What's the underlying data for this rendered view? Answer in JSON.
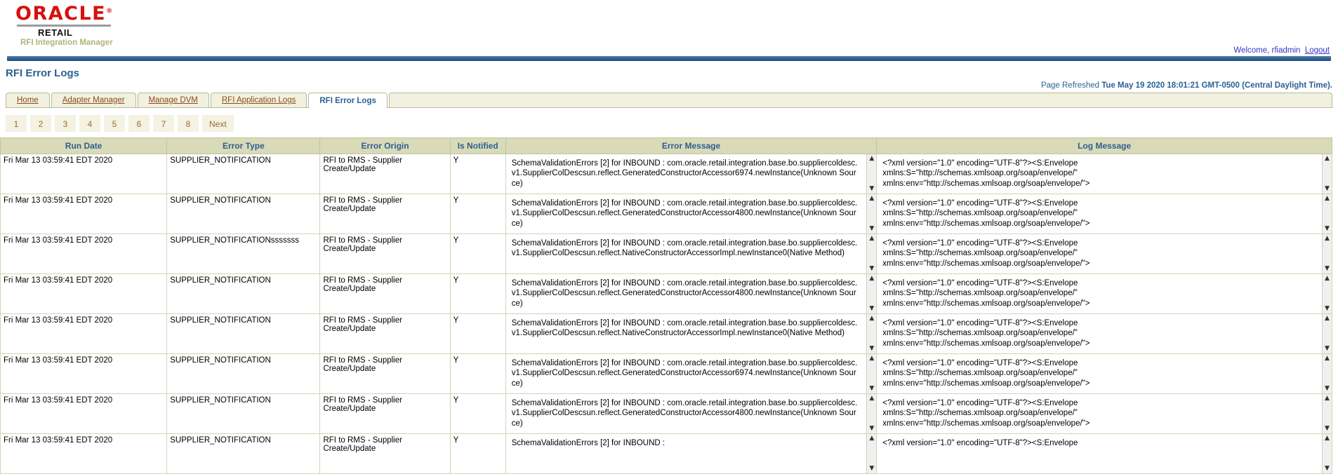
{
  "branding": {
    "oracle": "ORACLE",
    "registered": "®",
    "suite": "RETAIL",
    "app_name": "RFI Integration Manager"
  },
  "header": {
    "welcome": "Welcome, rfiadmin",
    "logout_label": "Logout"
  },
  "page": {
    "title": "RFI Error Logs",
    "refresh_label": "Page Refreshed",
    "refresh_value": "Tue May 19 2020 18:01:21 GMT-0500 (Central Daylight Time)."
  },
  "tabs": [
    {
      "label": "Home",
      "active": false
    },
    {
      "label": "Adapter Manager",
      "active": false
    },
    {
      "label": "Manage DVM",
      "active": false
    },
    {
      "label": "RFI Application Logs",
      "active": false
    },
    {
      "label": "RFI Error Logs",
      "active": true
    }
  ],
  "pager": [
    "1",
    "2",
    "3",
    "4",
    "5",
    "6",
    "7",
    "8",
    "Next"
  ],
  "table": {
    "columns": [
      "Run Date",
      "Error Type",
      "Error Origin",
      "Is Notified",
      "Error Message",
      "Log Message"
    ],
    "rows": [
      {
        "run_date": "Fri Mar 13 03:59:41 EDT 2020",
        "error_type": "SUPPLIER_NOTIFICATION",
        "error_origin": "RFI to RMS - Supplier Create/Update",
        "is_notified": "Y",
        "error_message": "SchemaValidationErrors [2] for INBOUND : com.oracle.retail.integration.base.bo.suppliercoldesc.v1.SupplierColDescsun.reflect.GeneratedConstructorAccessor6974.newInstance(Unknown Source)",
        "log_message": "<?xml version=\"1.0\" encoding=\"UTF-8\"?><S:Envelope\nxmlns:S=\"http://schemas.xmlsoap.org/soap/envelope/\"\nxmlns:env=\"http://schemas.xmlsoap.org/soap/envelope/\">"
      },
      {
        "run_date": "Fri Mar 13 03:59:41 EDT 2020",
        "error_type": "SUPPLIER_NOTIFICATION",
        "error_origin": "RFI to RMS - Supplier Create/Update",
        "is_notified": "Y",
        "error_message": "SchemaValidationErrors [2] for INBOUND : com.oracle.retail.integration.base.bo.suppliercoldesc.v1.SupplierColDescsun.reflect.GeneratedConstructorAccessor4800.newInstance(Unknown Source)",
        "log_message": "<?xml version=\"1.0\" encoding=\"UTF-8\"?><S:Envelope\nxmlns:S=\"http://schemas.xmlsoap.org/soap/envelope/\"\nxmlns:env=\"http://schemas.xmlsoap.org/soap/envelope/\">"
      },
      {
        "run_date": "Fri Mar 13 03:59:41 EDT 2020",
        "error_type": "SUPPLIER_NOTIFICATIONsssssss",
        "error_origin": "RFI to RMS - Supplier Create/Update",
        "is_notified": "Y",
        "error_message": "SchemaValidationErrors [2] for INBOUND : com.oracle.retail.integration.base.bo.suppliercoldesc.v1.SupplierColDescsun.reflect.NativeConstructorAccessorImpl.newInstance0(Native Method)",
        "log_message": "<?xml version=\"1.0\" encoding=\"UTF-8\"?><S:Envelope\nxmlns:S=\"http://schemas.xmlsoap.org/soap/envelope/\"\nxmlns:env=\"http://schemas.xmlsoap.org/soap/envelope/\">"
      },
      {
        "run_date": "Fri Mar 13 03:59:41 EDT 2020",
        "error_type": "SUPPLIER_NOTIFICATION",
        "error_origin": "RFI to RMS - Supplier Create/Update",
        "is_notified": "Y",
        "error_message": "SchemaValidationErrors [2] for INBOUND : com.oracle.retail.integration.base.bo.suppliercoldesc.v1.SupplierColDescsun.reflect.GeneratedConstructorAccessor4800.newInstance(Unknown Source)",
        "log_message": "<?xml version=\"1.0\" encoding=\"UTF-8\"?><S:Envelope\nxmlns:S=\"http://schemas.xmlsoap.org/soap/envelope/\"\nxmlns:env=\"http://schemas.xmlsoap.org/soap/envelope/\">"
      },
      {
        "run_date": "Fri Mar 13 03:59:41 EDT 2020",
        "error_type": "SUPPLIER_NOTIFICATION",
        "error_origin": "RFI to RMS - Supplier Create/Update",
        "is_notified": "Y",
        "error_message": "SchemaValidationErrors [2] for INBOUND : com.oracle.retail.integration.base.bo.suppliercoldesc.v1.SupplierColDescsun.reflect.NativeConstructorAccessorImpl.newInstance0(Native Method)",
        "log_message": "<?xml version=\"1.0\" encoding=\"UTF-8\"?><S:Envelope\nxmlns:S=\"http://schemas.xmlsoap.org/soap/envelope/\"\nxmlns:env=\"http://schemas.xmlsoap.org/soap/envelope/\">"
      },
      {
        "run_date": "Fri Mar 13 03:59:41 EDT 2020",
        "error_type": "SUPPLIER_NOTIFICATION",
        "error_origin": "RFI to RMS - Supplier Create/Update",
        "is_notified": "Y",
        "error_message": "SchemaValidationErrors [2] for INBOUND : com.oracle.retail.integration.base.bo.suppliercoldesc.v1.SupplierColDescsun.reflect.GeneratedConstructorAccessor6974.newInstance(Unknown Source)",
        "log_message": "<?xml version=\"1.0\" encoding=\"UTF-8\"?><S:Envelope\nxmlns:S=\"http://schemas.xmlsoap.org/soap/envelope/\"\nxmlns:env=\"http://schemas.xmlsoap.org/soap/envelope/\">"
      },
      {
        "run_date": "Fri Mar 13 03:59:41 EDT 2020",
        "error_type": "SUPPLIER_NOTIFICATION",
        "error_origin": "RFI to RMS - Supplier Create/Update",
        "is_notified": "Y",
        "error_message": "SchemaValidationErrors [2] for INBOUND : com.oracle.retail.integration.base.bo.suppliercoldesc.v1.SupplierColDescsun.reflect.GeneratedConstructorAccessor4800.newInstance(Unknown Source)",
        "log_message": "<?xml version=\"1.0\" encoding=\"UTF-8\"?><S:Envelope\nxmlns:S=\"http://schemas.xmlsoap.org/soap/envelope/\"\nxmlns:env=\"http://schemas.xmlsoap.org/soap/envelope/\">"
      },
      {
        "run_date": "Fri Mar 13 03:59:41 EDT 2020",
        "error_type": "SUPPLIER_NOTIFICATION",
        "error_origin": "RFI to RMS - Supplier Create/Update",
        "is_notified": "Y",
        "error_message": "SchemaValidationErrors [2] for INBOUND :",
        "log_message": "<?xml version=\"1.0\" encoding=\"UTF-8\"?><S:Envelope"
      }
    ]
  },
  "icons": {
    "scroll_up": "▲",
    "scroll_down": "▼"
  }
}
